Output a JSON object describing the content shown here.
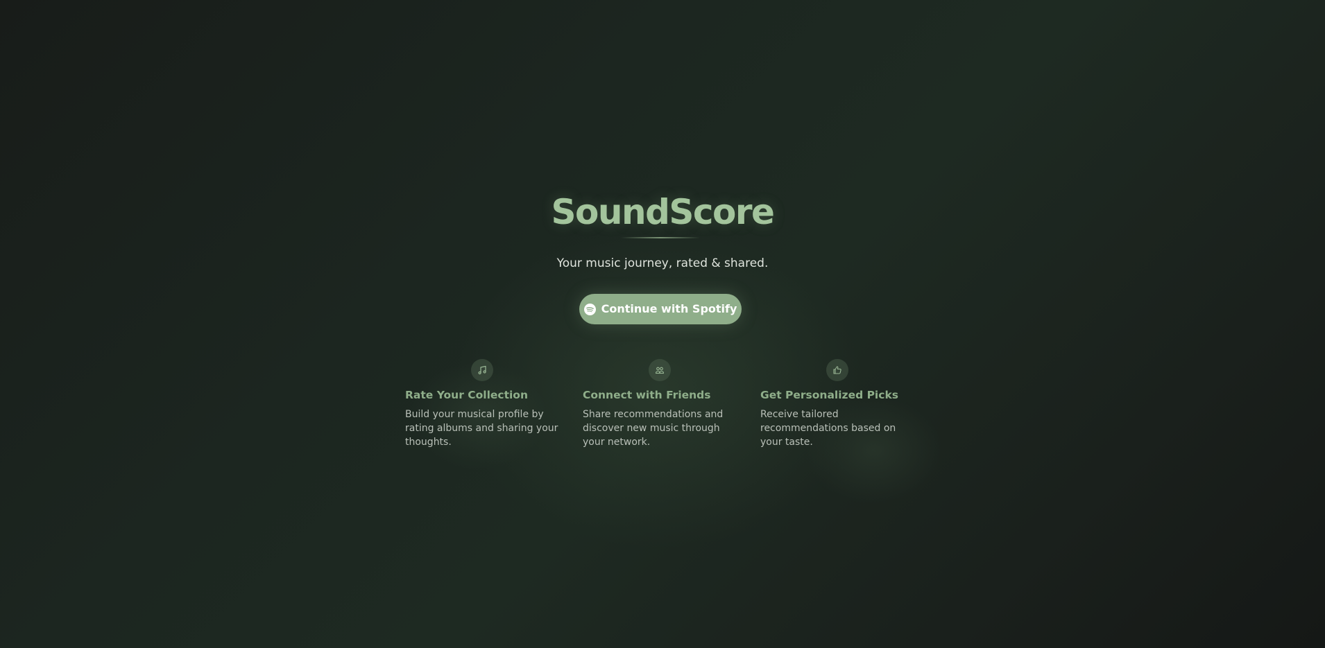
{
  "brand": {
    "title": "SoundScore",
    "tagline": "Your music journey, rated & shared."
  },
  "cta": {
    "label": "Continue with Spotify",
    "icon": "spotify-icon",
    "color": "#8fae8a"
  },
  "features": [
    {
      "icon": "music-note-icon",
      "title": "Rate Your Collection",
      "description": "Build your musical profile by rating albums and sharing your thoughts."
    },
    {
      "icon": "users-icon",
      "title": "Connect with Friends",
      "description": "Share recommendations and discover new music through your network."
    },
    {
      "icon": "thumbs-up-icon",
      "title": "Get Personalized Picks",
      "description": "Receive tailored recommendations based on your taste."
    }
  ],
  "colors": {
    "accent": "#a3c49c",
    "feature_title": "#8fae8a",
    "background": "#1c2620"
  }
}
